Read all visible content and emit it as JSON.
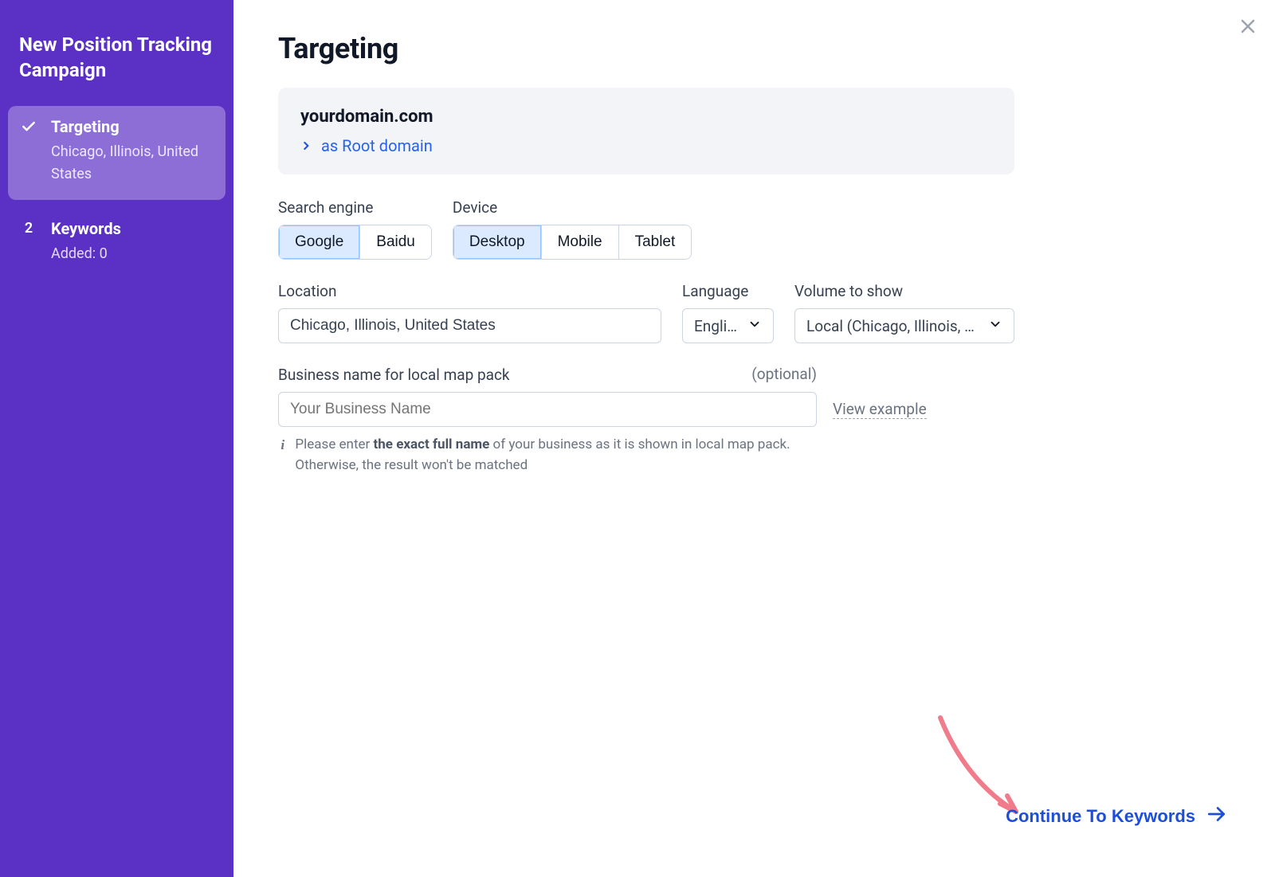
{
  "sidebar": {
    "title": "New Position Tracking Campaign",
    "steps": [
      {
        "label": "Targeting",
        "sub": "Chicago, Illinois, United States",
        "done": true
      },
      {
        "label": "Keywords",
        "sub": "Added: 0",
        "badge": "2"
      }
    ]
  },
  "page": {
    "title": "Targeting"
  },
  "domain_card": {
    "domain": "yourdomain.com",
    "link_text": "as Root domain"
  },
  "search_engine": {
    "label": "Search engine",
    "options": [
      "Google",
      "Baidu"
    ],
    "selected": "Google"
  },
  "device": {
    "label": "Device",
    "options": [
      "Desktop",
      "Mobile",
      "Tablet"
    ],
    "selected": "Desktop"
  },
  "location": {
    "label": "Location",
    "value": "Chicago, Illinois, United States"
  },
  "language": {
    "label": "Language",
    "value": "English"
  },
  "volume": {
    "label": "Volume to show",
    "value": "Local (Chicago, Illinois, …"
  },
  "business": {
    "label": "Business name for local map pack",
    "optional_label": "(optional)",
    "placeholder": "Your Business Name",
    "view_example": "View example",
    "helper_pre": "Please enter ",
    "helper_bold": "the exact full name",
    "helper_post": " of your business as it is shown in local map pack. Otherwise, the result won't be matched"
  },
  "continue_label": "Continue To Keywords"
}
